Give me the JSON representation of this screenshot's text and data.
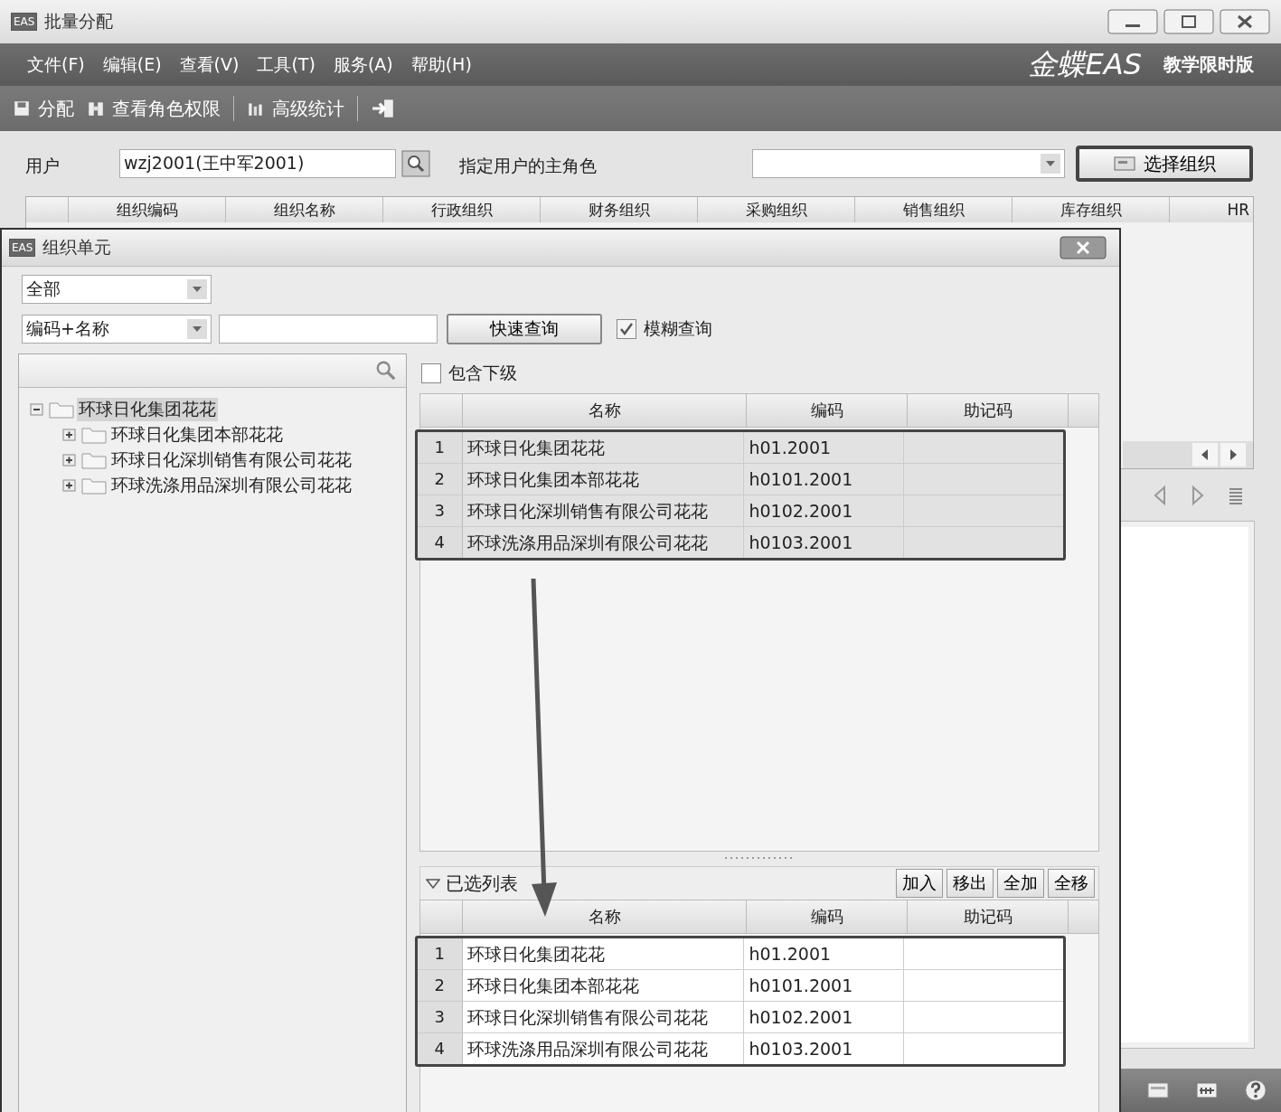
{
  "window": {
    "badge": "EAS",
    "title": "批量分配"
  },
  "menu": [
    "文件(F)",
    "编辑(E)",
    "查看(V)",
    "工具(T)",
    "服务(A)",
    "帮助(H)"
  ],
  "brand": {
    "logo": "金蝶EAS",
    "edition": "教学限时版"
  },
  "toolbar": [
    {
      "kind": "button",
      "label": "分配"
    },
    {
      "kind": "button",
      "label": "查看角色权限"
    },
    {
      "kind": "separator"
    },
    {
      "kind": "button",
      "label": "高级统计"
    },
    {
      "kind": "separator"
    },
    {
      "kind": "icon"
    }
  ],
  "user_row": {
    "user_label": "用户",
    "user_value": "wzj2001(王中军2001)",
    "role_label": "指定用户的主角色",
    "select_button": "选择组织"
  },
  "main_table": {
    "columns": [
      "组织编码",
      "组织名称",
      "行政组织",
      "财务组织",
      "采购组织",
      "销售组织",
      "库存组织",
      "HR"
    ]
  },
  "dialog": {
    "badge": "EAS",
    "title": "组织单元",
    "scope": "全部",
    "search_type": "编码+名称",
    "quick_search": "快速查询",
    "fuzzy": {
      "label": "模糊查询",
      "checked": true
    },
    "tree": [
      {
        "label": "环球日化集团花花",
        "selected": true,
        "expanded": true,
        "children": [
          {
            "label": "环球日化集团本部花花",
            "selected": false,
            "expanded": false
          },
          {
            "label": "环球日化深圳销售有限公司花花",
            "selected": false,
            "expanded": false
          },
          {
            "label": "环球洗涤用品深圳有限公司花花",
            "selected": false,
            "expanded": false
          }
        ]
      }
    ],
    "include_sub": {
      "label": "包含下级",
      "checked": false
    },
    "table": {
      "columns": [
        "名称",
        "编码",
        "助记码"
      ],
      "rows": [
        {
          "index": "1",
          "name": "环球日化集团花花",
          "code": "h01.2001"
        },
        {
          "index": "2",
          "name": "环球日化集团本部花花",
          "code": "h0101.2001"
        },
        {
          "index": "3",
          "name": "环球日化深圳销售有限公司花花",
          "code": "h0102.2001"
        },
        {
          "index": "4",
          "name": "环球洗涤用品深圳有限公司花花",
          "code": "h0103.2001"
        }
      ]
    },
    "selected_list": {
      "title": "已选列表",
      "buttons": [
        "加入",
        "移出",
        "全加",
        "全移"
      ],
      "table": {
        "columns": [
          "名称",
          "编码",
          "助记码"
        ],
        "rows": [
          {
            "index": "1",
            "name": "环球日化集团花花",
            "code": "h01.2001"
          },
          {
            "index": "2",
            "name": "环球日化集团本部花花",
            "code": "h0101.2001"
          },
          {
            "index": "3",
            "name": "环球日化深圳销售有限公司花花",
            "code": "h0102.2001"
          },
          {
            "index": "4",
            "name": "环球洗涤用品深圳有限公司花花",
            "code": "h0103.2001"
          }
        ]
      }
    }
  }
}
